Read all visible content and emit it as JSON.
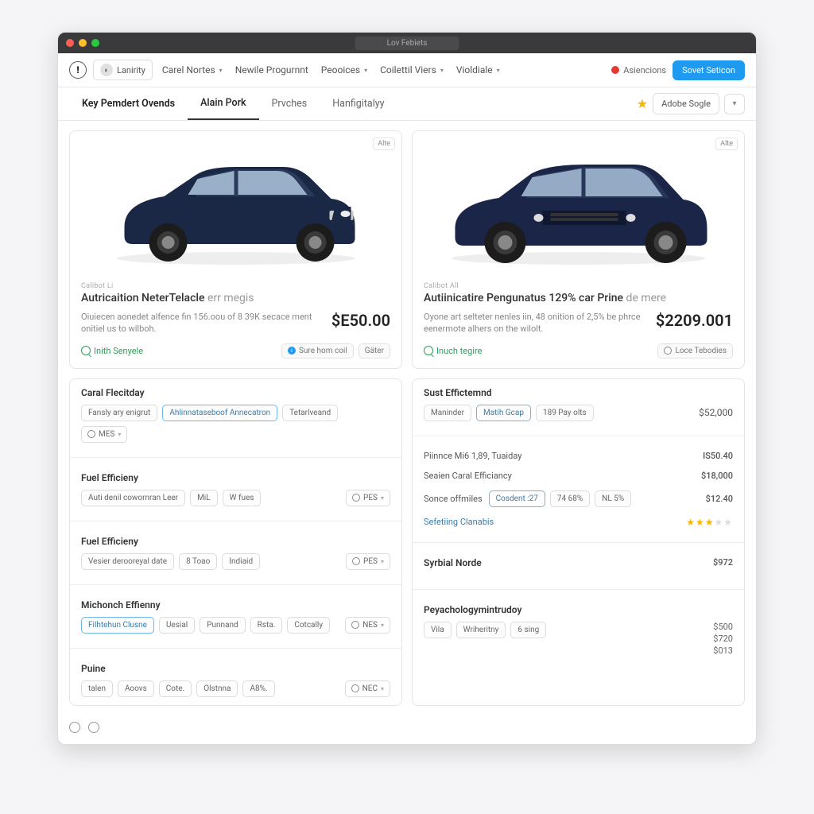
{
  "titlebar": {
    "url": "Lov Febiets"
  },
  "nav": {
    "laund": "Lanirity",
    "items": [
      "Carel Nortes",
      "Newile Progurnnt",
      "Peooices",
      "Coilettil Viers",
      "Violdiale"
    ],
    "alert": "Asiencions",
    "cta": "Sovet Seticon"
  },
  "tabs": {
    "items": [
      "Key Pemdert Ovends",
      "Alain Pork",
      "Prvches",
      "Hanfigitalyy"
    ],
    "action": "Adobe Sogle"
  },
  "cars": [
    {
      "mini": "Alte",
      "over": "Calibot Li",
      "title_em": "Autricaition NeterTelacle",
      "title_lt": "err megis",
      "desc": "Oiuiecen aonedet alfence fin 156.oou of 8 39K secace ment onitiel us to wilboh.",
      "price": "$E50.00",
      "ql": "Inith Senyele",
      "chip1": "Sure hom coil",
      "chip2": "Gäter"
    },
    {
      "mini": "Alte",
      "over": "Calibot All",
      "title_em": "Autiinicatire Pengunatus 129% car Prine",
      "title_lt": "de mere",
      "desc": "Oyone art selteter nenles iin, 48 onition of 2,5% be phrce eenermote alhers on the wilolt.",
      "price": "$2209.001",
      "ql": "Inuch tegire",
      "chip2": "Loce Tebodies"
    }
  ],
  "left": {
    "s1": {
      "h": "Caral Flecitday",
      "chips": [
        "Fansly ary enigrut",
        "Ahlinnataseboof Annecatron",
        "Tetarlveand"
      ],
      "dd": "MES"
    },
    "s2": {
      "h": "Fuel Efficieny",
      "chips": [
        "Auti denil cowornran Leer",
        "MiL",
        "W fues"
      ],
      "dd": "PES"
    },
    "s3": {
      "h": "Fuel Efficieny",
      "chips": [
        "Vesier derooreyal date",
        "8 Toao",
        "Indiaid"
      ],
      "dd": "PES"
    },
    "s4": {
      "h": "Michonch Effienny",
      "chips": [
        "Filhtehun Clusne",
        "Uesial",
        "Punnand",
        "Rsta.",
        "Cotcally"
      ],
      "dd": "NES"
    },
    "s5": {
      "h": "Puine",
      "chips": [
        "talen",
        "Aoovs",
        "Cote.",
        "Olstnna",
        "A8%."
      ],
      "dd": "NEC"
    }
  },
  "right": {
    "s1": {
      "h": "Sust Effictemnd",
      "chips": [
        "Maninder",
        "Matih Gcap",
        "189 Pay olts"
      ],
      "val": "$52,000"
    },
    "rows": [
      {
        "k": "Piinnce Mi6 1,89, Tuaiday",
        "v": "IS50.40"
      },
      {
        "k": "Seaien Caral Efficiancy",
        "v": "$18,000"
      },
      {
        "k": "Sonce offmiles",
        "chips": [
          "Cosdent :27",
          "74 68%",
          "NL 5%"
        ],
        "v": "$12.40"
      },
      {
        "k": "Sefetiing Clanabis",
        "stars": 3
      }
    ],
    "s2": {
      "h": "Syrbial Norde",
      "v": "$972"
    },
    "s3": {
      "h": "Peyachologymintrudoy",
      "chips": [
        "Vila",
        "Wriheritny",
        "6 sing"
      ],
      "vals": [
        "$500",
        "$720",
        "$013"
      ]
    }
  }
}
